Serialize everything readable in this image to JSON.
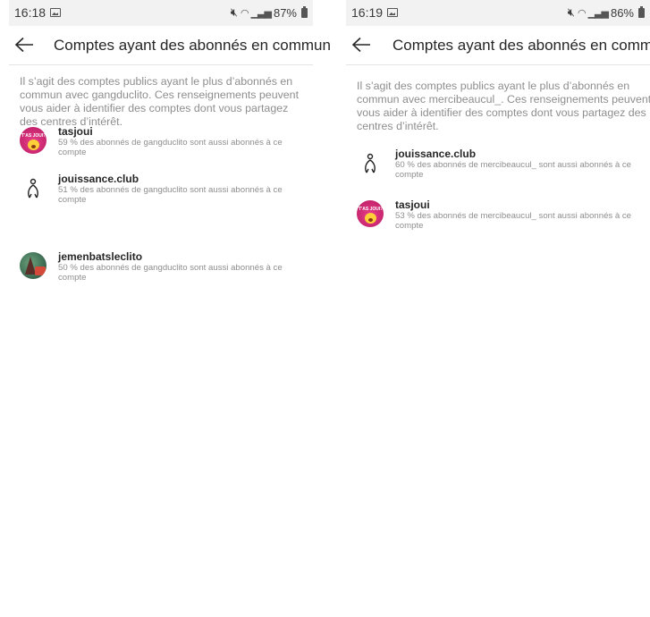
{
  "screens": [
    {
      "status": {
        "time": "16:18",
        "battery": "87%"
      },
      "title": "Comptes ayant des abonnés en commun",
      "description": "Il s’agit des comptes publics ayant le plus d’abonnés en commun avec gangduclito. Ces renseignements peuvent vous aider à identifier des comptes dont vous partagez des centres d’intérêt.",
      "accounts": [
        {
          "name": "tasjoui",
          "detail": "59 % des abonnés de gangduclito sont aussi abonnés à ce compte",
          "avatar": "tasjoui-avatar",
          "avatar_text": "T'AS JOUI?"
        },
        {
          "name": "jouissance.club",
          "detail": "51 % des abonnés de gangduclito sont aussi abonnés à ce compte",
          "avatar": "clitoris-symbol-avatar"
        },
        {
          "name": "jemenbatsleclito",
          "detail": "50 % des abonnés de gangduclito sont aussi abonnés à ce compte",
          "avatar": "christmas-photo-avatar"
        }
      ]
    },
    {
      "status": {
        "time": "16:19",
        "battery": "86%"
      },
      "title": "Comptes ayant des abonnés en commun",
      "description": "Il s’agit des comptes publics ayant le plus d’abonnés en commun avec mercibeaucul_. Ces renseignements peuvent vous aider à identifier des comptes dont vous partagez des centres d’intérêt.",
      "accounts": [
        {
          "name": "jouissance.club",
          "detail": "60 % des abonnés de mercibeaucul_ sont aussi abonnés à ce compte",
          "avatar": "clitoris-symbol-avatar"
        },
        {
          "name": "tasjoui",
          "detail": "53 % des abonnés de mercibeaucul_ sont aussi abonnés à ce compte",
          "avatar": "tasjoui-avatar",
          "avatar_text": "T'AS JOUI?"
        }
      ]
    }
  ],
  "icons": {
    "back": "arrow-left-icon",
    "gallery": "gallery-icon",
    "mute": "mute-icon",
    "wifi": "wifi-icon",
    "signal": "signal-icon",
    "battery": "battery-icon"
  },
  "colors": {
    "text": "#262626",
    "secondary": "#8e8e8e",
    "statusbar": "#f2f2f2",
    "divider": "#e4e4e4"
  }
}
